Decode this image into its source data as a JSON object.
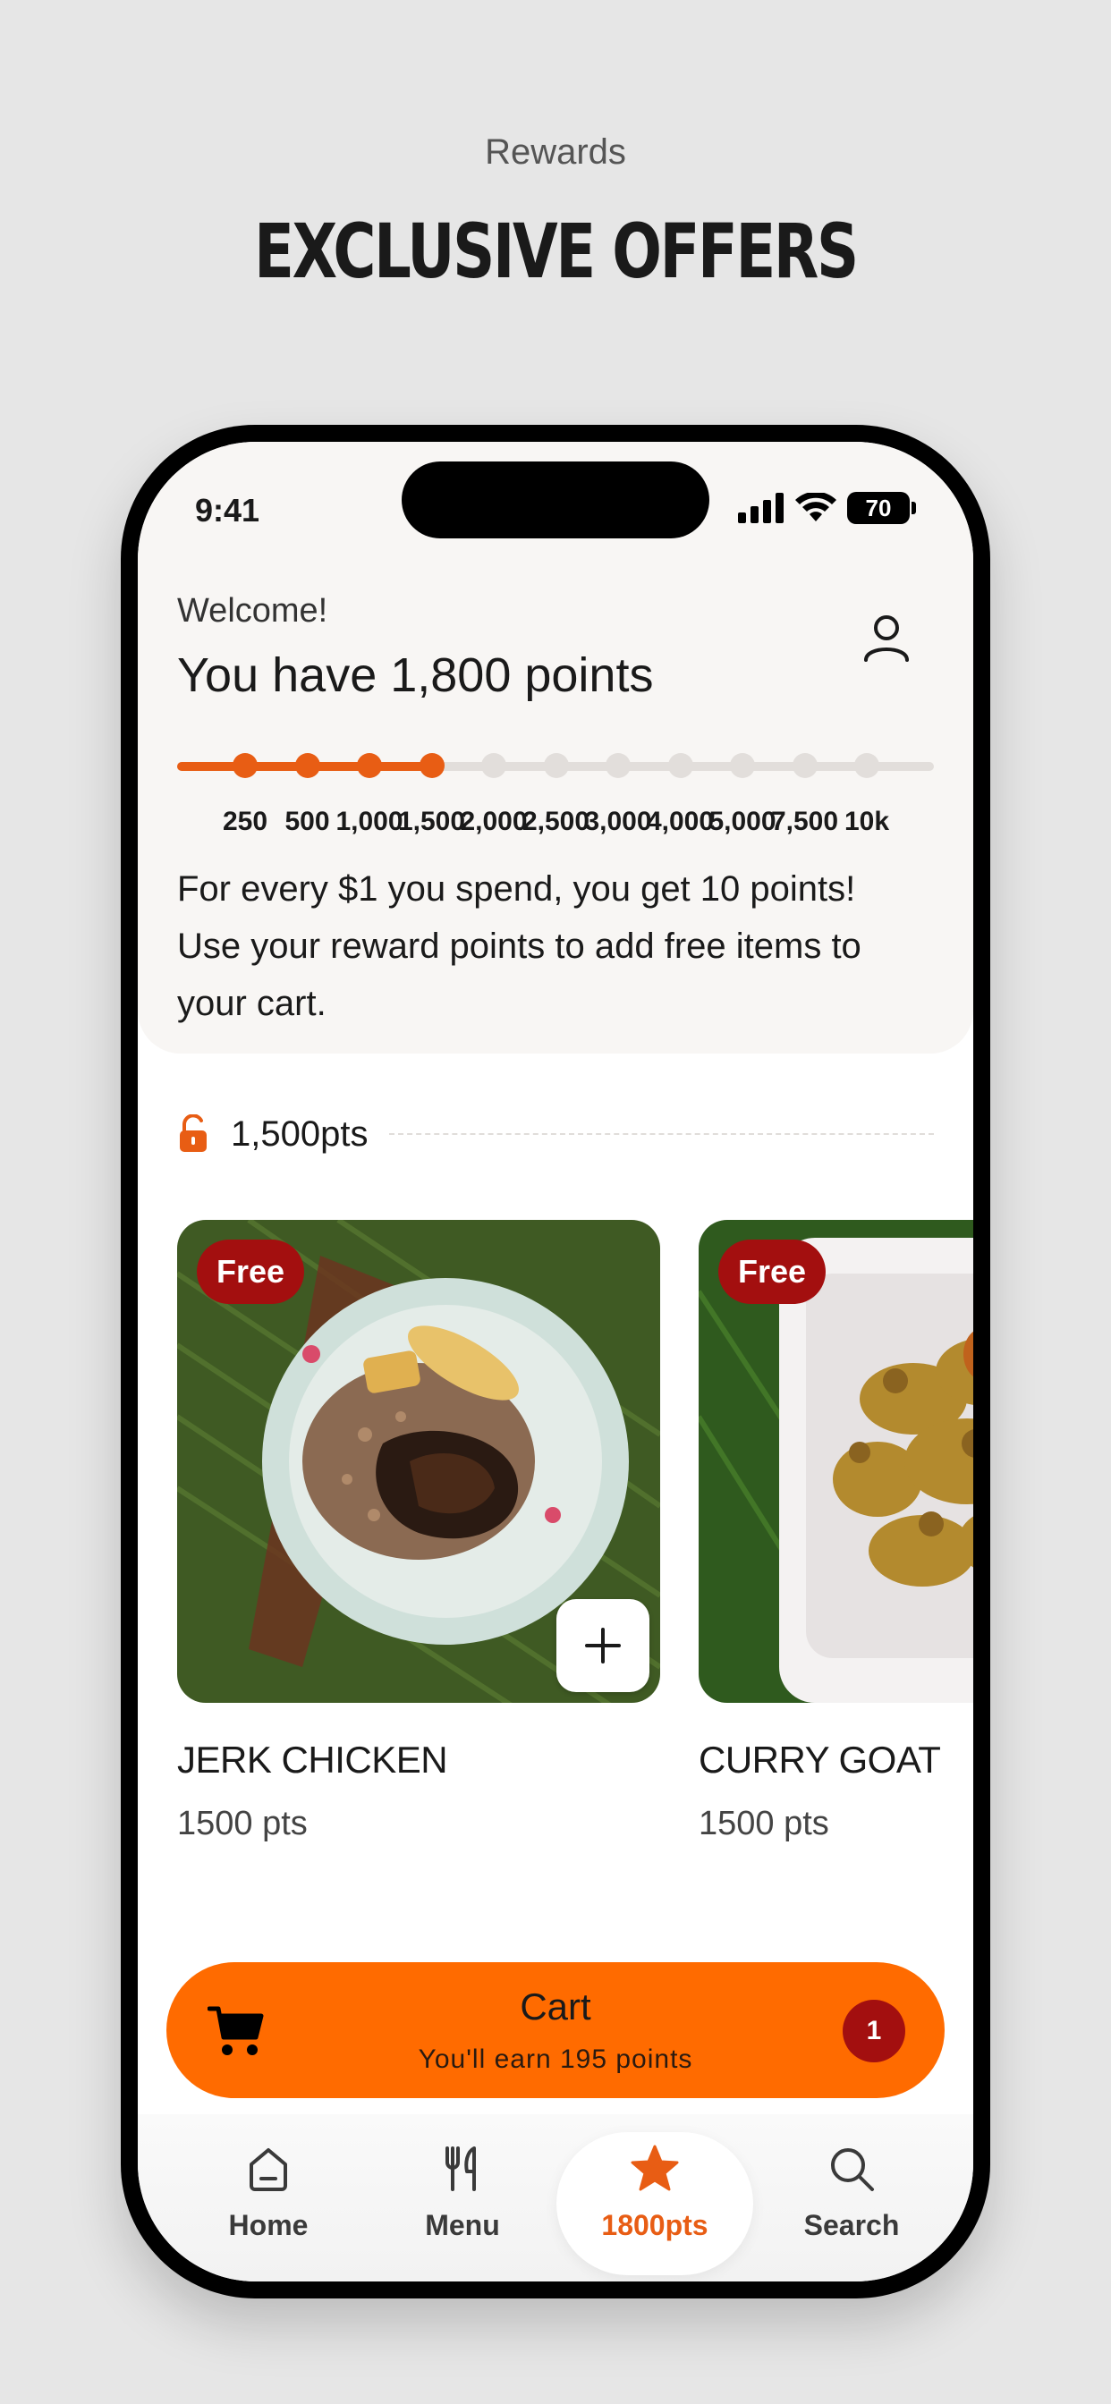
{
  "promo": {
    "subtitle": "Rewards",
    "title": "EXCLUSIVE OFFERS"
  },
  "status_bar": {
    "time": "9:41",
    "battery": "70"
  },
  "header": {
    "welcome": "Welcome!",
    "points_title": "You have 1,800 points",
    "info": "For every $1 you spend, you get 10 points! Use your reward points to add free items to your cart."
  },
  "progress": {
    "current_points": 1800,
    "milestones": [
      {
        "label": "250",
        "value": 250,
        "reached": true
      },
      {
        "label": "500",
        "value": 500,
        "reached": true
      },
      {
        "label": "1,000",
        "value": 1000,
        "reached": true
      },
      {
        "label": "1,500",
        "value": 1500,
        "reached": true
      },
      {
        "label": "2,000",
        "value": 2000,
        "reached": false
      },
      {
        "label": "2,500",
        "value": 2500,
        "reached": false
      },
      {
        "label": "3,000",
        "value": 3000,
        "reached": false
      },
      {
        "label": "4,000",
        "value": 4000,
        "reached": false
      },
      {
        "label": "5,000",
        "value": 5000,
        "reached": false
      },
      {
        "label": "7,500",
        "value": 7500,
        "reached": false
      },
      {
        "label": "10k",
        "value": 10000,
        "reached": false
      }
    ],
    "accent": "#e85d14"
  },
  "tier": {
    "label": "1,500pts"
  },
  "items": [
    {
      "badge": "Free",
      "name": "JERK CHICKEN",
      "points": "1500 pts"
    },
    {
      "badge": "Free",
      "name": "CURRY GOAT",
      "points": "1500 pts"
    }
  ],
  "cart": {
    "title": "Cart",
    "subtitle": "You'll earn 195 points",
    "count": "1",
    "color": "#ff6b00"
  },
  "tabs": [
    {
      "label": "Home",
      "icon": "home-icon"
    },
    {
      "label": "Menu",
      "icon": "utensils-icon"
    },
    {
      "label": "1800pts",
      "icon": "star-icon",
      "active": true
    },
    {
      "label": "Search",
      "icon": "search-icon"
    }
  ]
}
